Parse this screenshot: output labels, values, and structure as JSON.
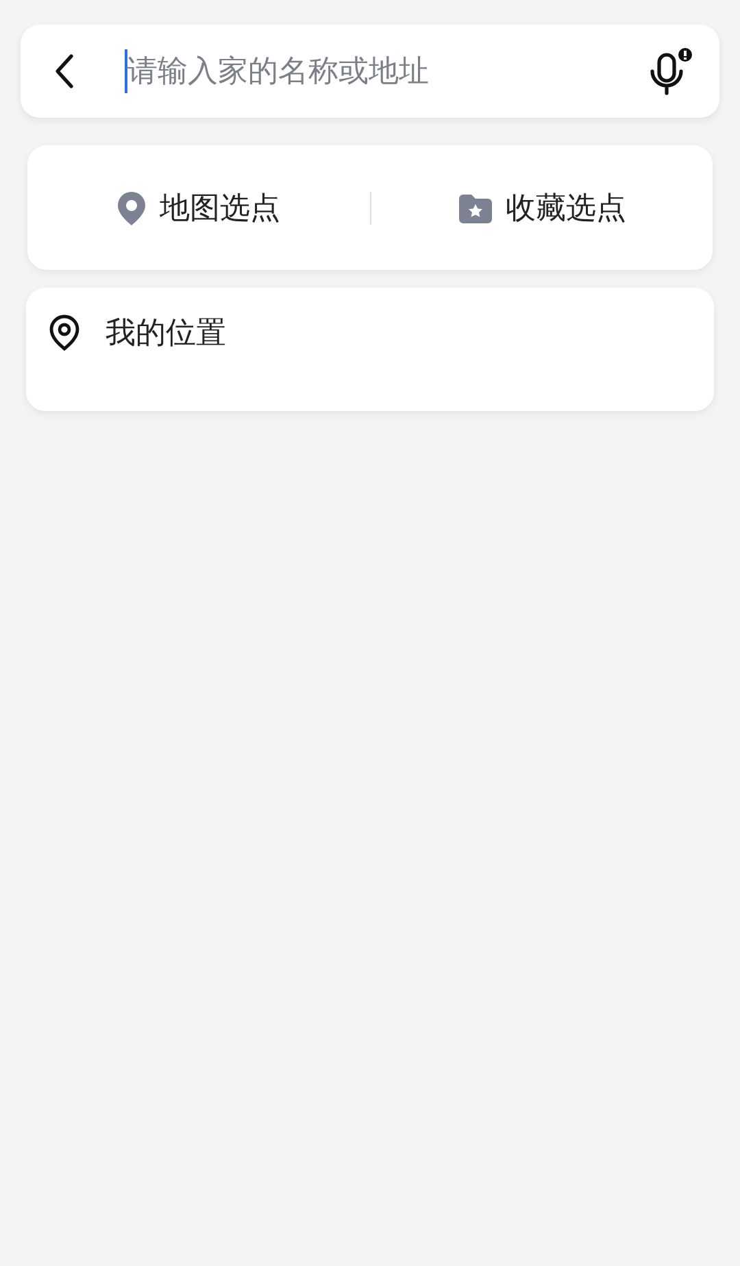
{
  "search": {
    "placeholder": "请输入家的名称或地址"
  },
  "quick_picks": [
    {
      "kind": "map",
      "label": "地图选点"
    },
    {
      "kind": "favorites",
      "label": "收藏选点"
    }
  ],
  "locations": [
    {
      "label": "我的位置"
    }
  ]
}
